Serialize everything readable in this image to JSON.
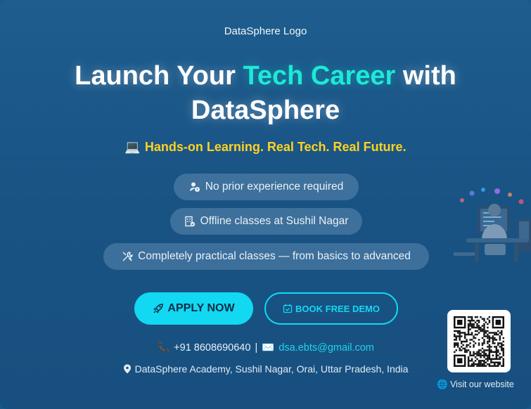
{
  "logo": {
    "alt_text": "DataSphere Logo"
  },
  "headline": {
    "part1": "Launch Your ",
    "accent": "Tech Career",
    "part2": " with",
    "line2": "DataSphere"
  },
  "tagline": {
    "emoji": "💻",
    "text": "Hands-on Learning. Real Tech. Real Future."
  },
  "features": [
    {
      "icon": "user-check-icon",
      "text": "No prior experience required"
    },
    {
      "icon": "building-icon",
      "text": "Offline classes at Sushil Nagar"
    },
    {
      "icon": "tools-icon",
      "text": "Completely practical classes — from basics to advanced"
    }
  ],
  "buttons": {
    "apply": "APPLY NOW",
    "demo": "BOOK FREE DEMO"
  },
  "contact": {
    "phone": "+91 8608690640",
    "separator": "|",
    "email": "dsa.ebts@gmail.com",
    "address": "DataSphere Academy, Sushil Nagar, Orai, Uttar Pradesh, India"
  },
  "website": {
    "label": "Visit our website"
  },
  "colors": {
    "accent": "#1de9d6",
    "tagline": "#ffd21f",
    "button": "#12d8f2",
    "background": "#1a5a8a"
  }
}
